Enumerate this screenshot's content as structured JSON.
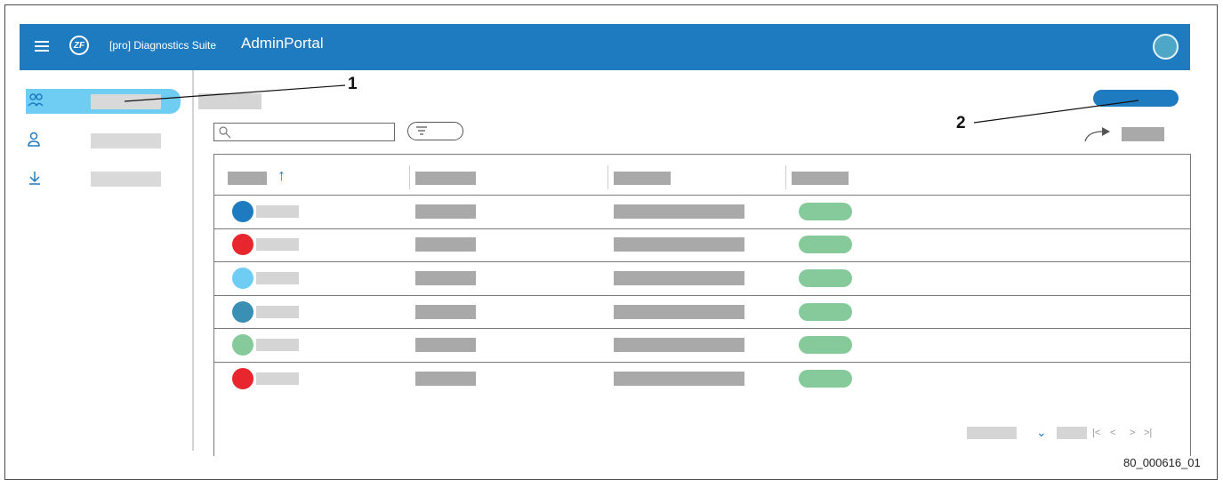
{
  "header": {
    "suite_label": "[pro] Diagnostics Suite",
    "app_title": "AdminPortal",
    "logo_text": "ZF"
  },
  "sidebar": {
    "items": [
      {
        "icon": "users-icon",
        "active": true
      },
      {
        "icon": "user-icon",
        "active": false
      },
      {
        "icon": "download-icon",
        "active": false
      }
    ]
  },
  "table": {
    "sort_indicator": "↑",
    "rows": [
      {
        "color": "#1f7bbf"
      },
      {
        "color": "#e8262e"
      },
      {
        "color": "#6fcdf3"
      },
      {
        "color": "#3a8fb5"
      },
      {
        "color": "#86c99b"
      },
      {
        "color": "#e8262e"
      }
    ],
    "status_color": "#86c99b"
  },
  "pagination": {
    "dropdown_glyph": "⌄",
    "first_glyph": "|<",
    "prev_glyph": "<",
    "next_glyph": ">",
    "last_glyph": ">|"
  },
  "callouts": [
    "1",
    "2"
  ],
  "figure_code": "80_000616_01",
  "colors": {
    "brand_blue": "#1f7bbf",
    "active_nav": "#6fcdf3"
  }
}
